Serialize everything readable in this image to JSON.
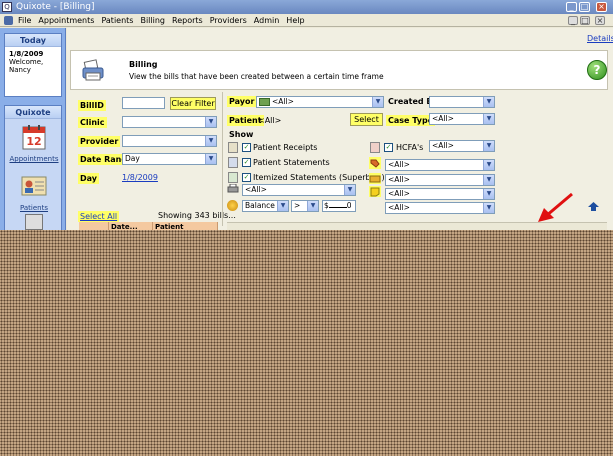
{
  "window": {
    "title": "Quixote - [Billing]"
  },
  "menu": [
    "File",
    "Appointments",
    "Patients",
    "Billing",
    "Reports",
    "Providers",
    "Admin",
    "Help"
  ],
  "sidebar": {
    "today": {
      "header": "Today",
      "date": "1/8/2009",
      "welcome": "Welcome,",
      "user": "Nancy"
    },
    "quixote": {
      "header": "Quixote"
    },
    "nav": [
      {
        "label": "Appointments",
        "icon": "calendar-icon",
        "calendar_day": "12"
      },
      {
        "label": "Patients",
        "icon": "patient-card-icon"
      }
    ]
  },
  "header": {
    "details_link": "Details"
  },
  "banner": {
    "title": "Billing",
    "description": "View the bills that have been created between a certain time frame"
  },
  "filters": {
    "bill_id": {
      "label": "BillID",
      "value": ""
    },
    "clear_filter": "Clear Filter",
    "clinic": {
      "label": "Clinic",
      "value": ""
    },
    "provider": {
      "label": "Provider",
      "value": ""
    },
    "date_range": {
      "label": "Date Range",
      "value": "Day"
    },
    "day": {
      "label": "Day",
      "value": "1/8/2009"
    },
    "payor": {
      "label": "Payor",
      "value": "<All>"
    },
    "created_by": {
      "label": "Created By",
      "value": ""
    },
    "patient": {
      "label": "Patient",
      "value": "<All>"
    },
    "select_button": "Select",
    "case_type": {
      "label": "Case Type",
      "value": "<All>"
    }
  },
  "show": {
    "label": "Show",
    "patient_receipts": "Patient Receipts",
    "patient_statements": "Patient Statements",
    "itemized_statements": "Itemized Statements (Superbills)",
    "hcfas": "HCFA's",
    "hcfas_value": "<All>",
    "right_dropdowns": [
      "<All>",
      "<All>",
      "<All>",
      "<All>"
    ],
    "printer_dropdown": "<All>",
    "balance_field": "Balance",
    "operator": ">",
    "currency": "$",
    "amount": "0"
  },
  "list": {
    "select_all": "Select All",
    "showing": "Showing 343 bills...",
    "columns": [
      "Date...",
      "Patient"
    ]
  },
  "colors": {
    "highlight": "#ffff66",
    "link": "#1a3cc0",
    "annotation_arrow": "#e01010"
  }
}
